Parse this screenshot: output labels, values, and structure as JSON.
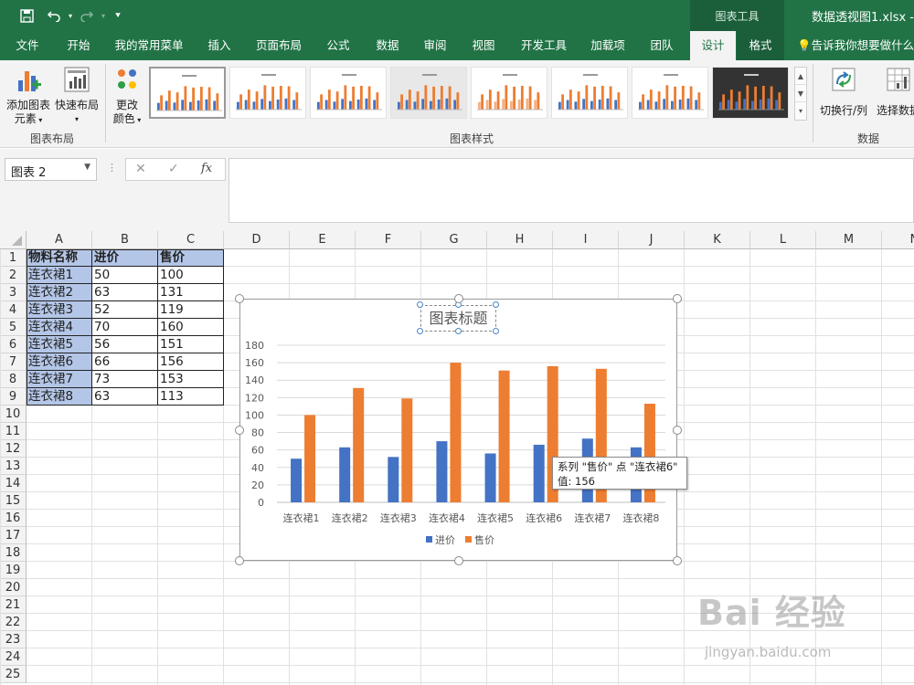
{
  "title_bar": {
    "chart_tools_label": "图表工具",
    "document_title": "数据透视图1.xlsx  -"
  },
  "tabs": [
    {
      "label": "文件"
    },
    {
      "label": "开始"
    },
    {
      "label": "我的常用菜单"
    },
    {
      "label": "插入"
    },
    {
      "label": "页面布局"
    },
    {
      "label": "公式"
    },
    {
      "label": "数据"
    },
    {
      "label": "审阅"
    },
    {
      "label": "视图"
    },
    {
      "label": "开发工具"
    },
    {
      "label": "加载项"
    },
    {
      "label": "团队"
    },
    {
      "label": "设计"
    },
    {
      "label": "格式"
    }
  ],
  "tell_me": "告诉我你想要做什么",
  "ribbon": {
    "add_element_line1": "添加图表",
    "add_element_line2": "元素",
    "quick_layout": "快速布局",
    "change_colors_line1": "更改",
    "change_colors_line2": "颜色",
    "group_layout": "图表布局",
    "group_styles": "图表样式",
    "switch_row_col": "切换行/列",
    "select_data": "选择数据",
    "group_data": "数据"
  },
  "formula_bar": {
    "name_box": "图表 2",
    "formula": ""
  },
  "columns": [
    "A",
    "B",
    "C",
    "D",
    "E",
    "F",
    "G",
    "H",
    "I",
    "J",
    "K",
    "L",
    "M",
    "N"
  ],
  "rows": [
    "1",
    "2",
    "3",
    "4",
    "5",
    "6",
    "7",
    "8",
    "9",
    "10",
    "11",
    "12",
    "13",
    "14",
    "15",
    "16",
    "17",
    "18",
    "19",
    "20",
    "21",
    "22",
    "23",
    "24",
    "25"
  ],
  "table": {
    "headers": [
      "物料名称",
      "进价",
      "售价"
    ],
    "rows": [
      [
        "连衣裙1",
        "50",
        "100"
      ],
      [
        "连衣裙2",
        "63",
        "131"
      ],
      [
        "连衣裙3",
        "52",
        "119"
      ],
      [
        "连衣裙4",
        "70",
        "160"
      ],
      [
        "连衣裙5",
        "56",
        "151"
      ],
      [
        "连衣裙6",
        "66",
        "156"
      ],
      [
        "连衣裙7",
        "73",
        "153"
      ],
      [
        "连衣裙8",
        "63",
        "113"
      ]
    ]
  },
  "chart_data": {
    "type": "bar",
    "title": "图表标题",
    "categories": [
      "连衣裙1",
      "连衣裙2",
      "连衣裙3",
      "连衣裙4",
      "连衣裙5",
      "连衣裙6",
      "连衣裙7",
      "连衣裙8"
    ],
    "series": [
      {
        "name": "进价",
        "values": [
          50,
          63,
          52,
          70,
          56,
          66,
          73,
          63
        ],
        "color": "#4472c4"
      },
      {
        "name": "售价",
        "values": [
          100,
          131,
          119,
          160,
          151,
          156,
          153,
          113
        ],
        "color": "#ed7d31"
      }
    ],
    "yticks": [
      0,
      20,
      40,
      60,
      80,
      100,
      120,
      140,
      160,
      180
    ],
    "ylim": [
      0,
      180
    ],
    "grid": true,
    "legend": "bottom"
  },
  "tooltip": {
    "line1": "系列 \"售价\" 点 \"连衣裙6\"",
    "line2": "值: 156"
  },
  "watermark": {
    "brand": "Bai 经验",
    "url": "jingyan.baidu.com"
  },
  "colors": {
    "excel_green": "#217346",
    "header_fill": "#b4c6e7"
  }
}
